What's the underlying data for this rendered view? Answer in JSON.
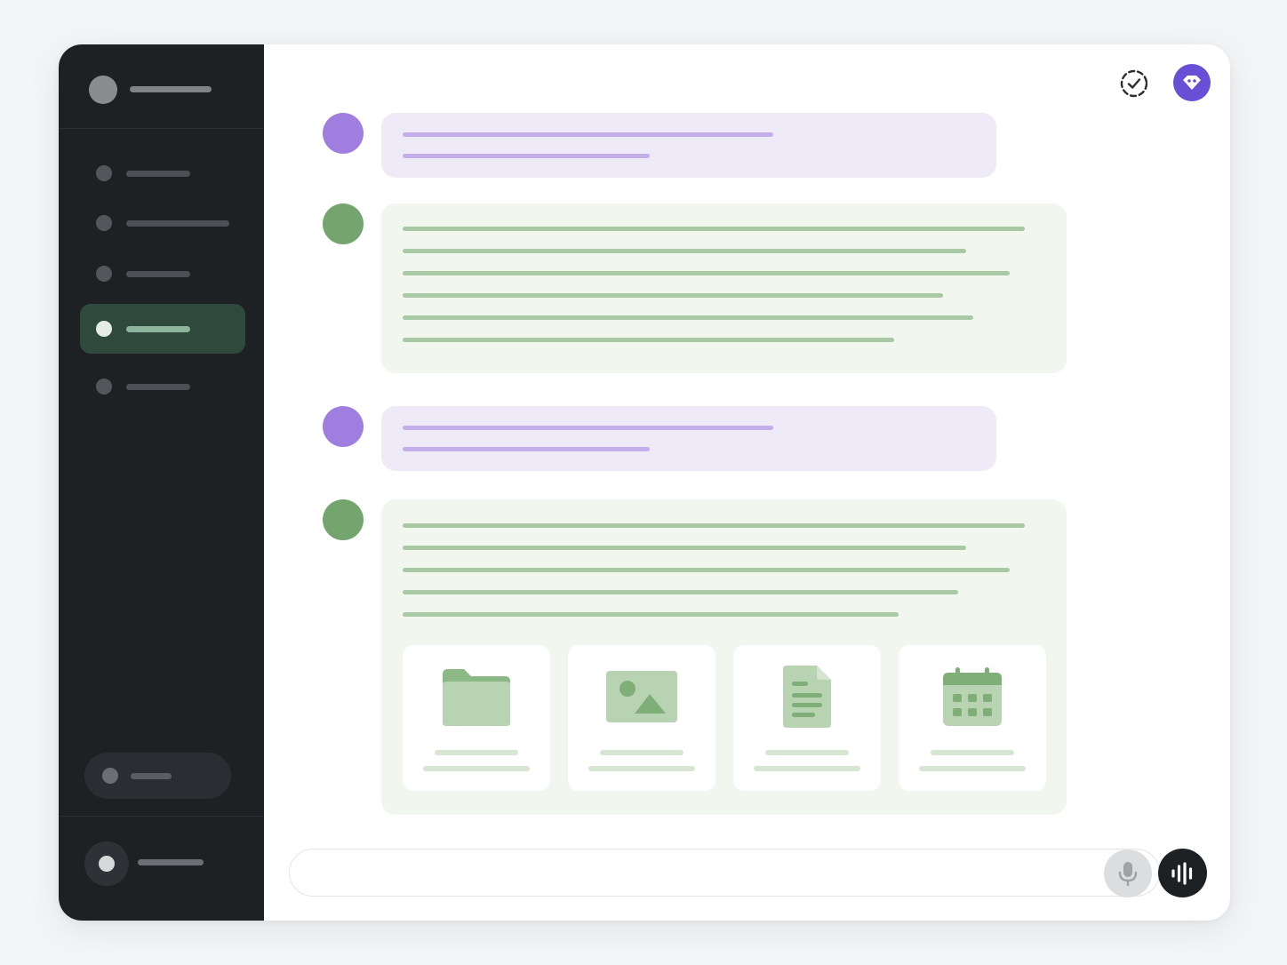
{
  "sidebar": {
    "workspace": {
      "avatar": "workspace-avatar",
      "name": ""
    },
    "nav_items": [
      {
        "id": "nav-1",
        "label": "",
        "active": false
      },
      {
        "id": "nav-2",
        "label": "",
        "active": false
      },
      {
        "id": "nav-3",
        "label": "",
        "active": false
      },
      {
        "id": "nav-4",
        "label": "",
        "active": true
      },
      {
        "id": "nav-5",
        "label": "",
        "active": false
      }
    ],
    "upgrade": {
      "label": ""
    },
    "user": {
      "avatar": "user-avatar",
      "name": ""
    }
  },
  "header": {
    "icons": [
      "task-status-icon",
      "brand-logo-icon"
    ]
  },
  "conversation": {
    "messages": [
      {
        "role": "user",
        "text": ""
      },
      {
        "role": "assistant",
        "text": ""
      },
      {
        "role": "user",
        "text": ""
      },
      {
        "role": "assistant",
        "text": "",
        "attachments": [
          {
            "type": "folder",
            "icon": "folder-icon",
            "title": "",
            "meta": ""
          },
          {
            "type": "image",
            "icon": "image-icon",
            "title": "",
            "meta": ""
          },
          {
            "type": "document",
            "icon": "document-icon",
            "title": "",
            "meta": ""
          },
          {
            "type": "calendar",
            "icon": "calendar-icon",
            "title": "",
            "meta": ""
          }
        ]
      }
    ]
  },
  "composer": {
    "placeholder": "",
    "mic_icon": "microphone-icon",
    "voice_icon": "voice-waveform-icon"
  },
  "colors": {
    "sidebar_bg": "#1e2124",
    "active_nav": "#2f4a3d",
    "user_accent": "#a07ee0",
    "user_bubble": "#efeaf8",
    "assistant_accent": "#74a56f",
    "assistant_bubble": "#f1f6ef",
    "brand": "#6750d6"
  }
}
